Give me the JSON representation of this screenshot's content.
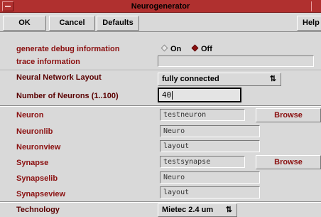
{
  "window": {
    "title": "Neurogenerator"
  },
  "toolbar": {
    "ok": "OK",
    "cancel": "Cancel",
    "defaults": "Defaults",
    "help": "Help"
  },
  "form": {
    "debug": {
      "label": "generate debug information",
      "options": [
        "On",
        "Off"
      ],
      "selected": "Off"
    },
    "trace": {
      "label": "trace information",
      "value": ""
    },
    "layout": {
      "label": "Neural Network Layout",
      "value": "fully connected"
    },
    "neurons": {
      "label": "Number of Neurons (1..100)",
      "value": "40"
    },
    "neuron": {
      "label": "Neuron",
      "value": "testneuron",
      "browse": "Browse"
    },
    "neuronlib": {
      "label": "Neuronlib",
      "value": "Neuro"
    },
    "neuronview": {
      "label": "Neuronview",
      "value": "layout"
    },
    "synapse": {
      "label": "Synapse",
      "value": "testsynapse",
      "browse": "Browse"
    },
    "synapselib": {
      "label": "Synapselib",
      "value": "Neuro"
    },
    "synapseview": {
      "label": "Synapseview",
      "value": "layout"
    },
    "technology": {
      "label": "Technology",
      "value": "Mietec 2.4 um"
    }
  },
  "icons": {
    "menu_arrow": "up-down-arrow-icon"
  }
}
